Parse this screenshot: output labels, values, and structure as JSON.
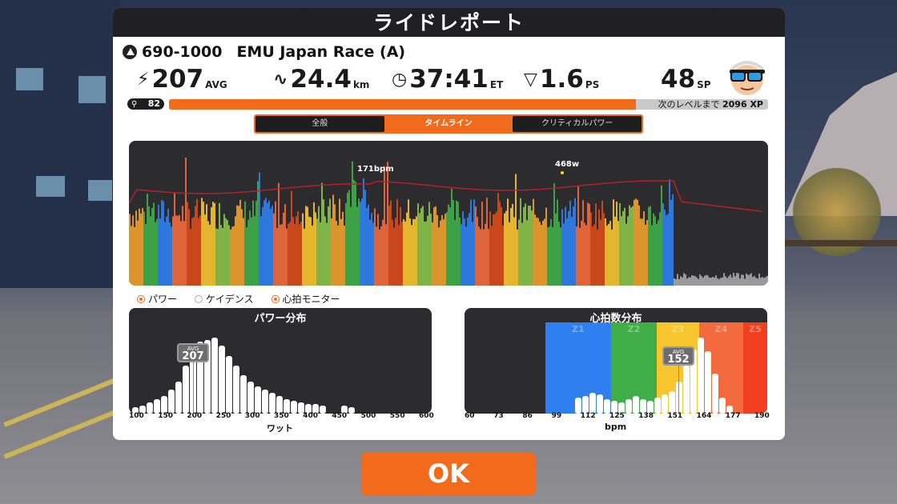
{
  "header": {
    "title": "ライドレポート"
  },
  "race": {
    "code": "690-1000",
    "name": "EMU Japan Race (A)"
  },
  "stats": {
    "power": {
      "value": "207",
      "unit": "AVG"
    },
    "distance": {
      "value": "24.4",
      "unit": "km"
    },
    "time": {
      "value": "37:41",
      "unit": "ET"
    },
    "pizza": {
      "value": "1.6",
      "unit": "PS"
    },
    "sport_points": {
      "value": "48",
      "unit": "SP"
    }
  },
  "level": {
    "value": "82",
    "progress": 0.78,
    "next_label": "次のレベルまで",
    "xp": "2096 XP"
  },
  "tabs": [
    {
      "label": "全般",
      "active": false
    },
    {
      "label": "タイムライン",
      "active": true
    },
    {
      "label": "クリティカルパワー",
      "active": false
    }
  ],
  "timeline": {
    "hr_label": "171bpm",
    "peak_label": "468w"
  },
  "legend": [
    {
      "label": "パワー",
      "on": true
    },
    {
      "label": "ケイデンス",
      "on": false
    },
    {
      "label": "心拍モニター",
      "on": true
    }
  ],
  "power_dist": {
    "title": "パワー分布",
    "avg_title": "AVG",
    "avg_value": "207",
    "ticks": [
      "100",
      "150",
      "200",
      "250",
      "300",
      "350",
      "400",
      "450",
      "500",
      "550",
      "600"
    ],
    "xlabel": "ワット"
  },
  "hr_dist": {
    "title": "心拍数分布",
    "avg_title": "AVG",
    "avg_value": "152",
    "zones": [
      {
        "label": "Z1",
        "color": "#2f7ff0"
      },
      {
        "label": "Z2",
        "color": "#3fae49"
      },
      {
        "label": "Z3",
        "color": "#f7c52e"
      },
      {
        "label": "Z4",
        "color": "#f26a3d"
      },
      {
        "label": "Z5",
        "color": "#f0401f"
      }
    ],
    "ticks": [
      "60",
      "73",
      "86",
      "99",
      "112",
      "125",
      "138",
      "151",
      "164",
      "177",
      "190"
    ],
    "xlabel": "bpm"
  },
  "ok_button": {
    "label": "OK"
  },
  "colors": {
    "accent": "#f26a1b",
    "panel_dark": "#2c2c2e"
  }
}
